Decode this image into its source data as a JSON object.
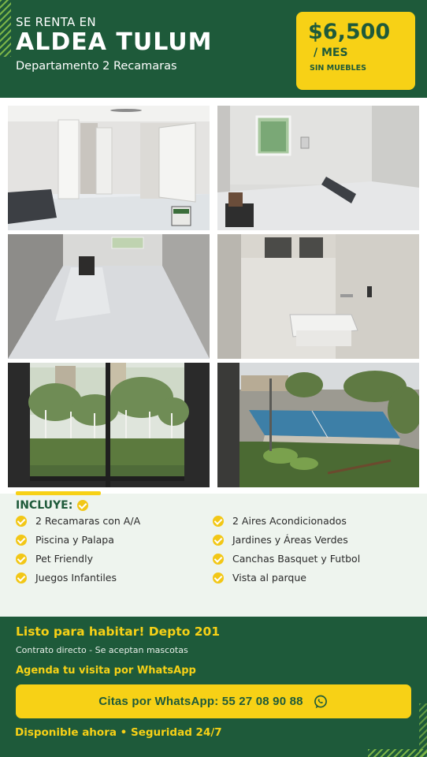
{
  "header": {
    "over_title": "SE RENTA EN",
    "title": "ALDEA TULUM",
    "subtitle": "Departamento 2 Recamaras"
  },
  "price": {
    "amount": "$6,500",
    "period": "/ MES",
    "note": "SIN MUEBLES"
  },
  "gallery": {
    "photos": [
      {
        "subject": "living room with doors and ceiling fan"
      },
      {
        "subject": "bedroom with window"
      },
      {
        "subject": "hallway with marble floor"
      },
      {
        "subject": "laundry area with sink"
      },
      {
        "subject": "window view of trees"
      },
      {
        "subject": "sports courts and garden"
      }
    ]
  },
  "includes": {
    "title": "INCLUYE:",
    "items": [
      "2 Recamaras con A/A",
      "2 Aires Acondicionados",
      "Piscina y Palapa",
      "Jardines y Áreas Verdes",
      "Pet Friendly",
      "Canchas Basquet y Futbol",
      "Juegos Infantiles",
      "Vista al parque"
    ]
  },
  "footer": {
    "ready": "Listo para habitar! Depto 201",
    "contract": "Contrato directo - Se aceptan mascotas",
    "agenda": "Agenda tu visita por WhatsApp",
    "cta_label": "Citas por WhatsApp: 55 27 08 90 88",
    "cta_icon": "whatsapp-icon",
    "available": "Disponible ahora • Seguridad 24/7"
  },
  "colors": {
    "primary_green": "#1e5a3a",
    "accent_yellow": "#f7d116",
    "light_background": "#eef4ee"
  }
}
